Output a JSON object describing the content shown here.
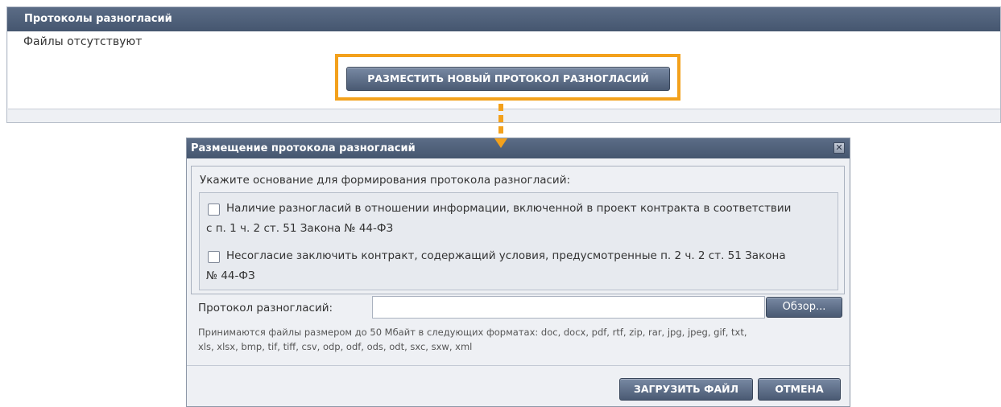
{
  "panel": {
    "title": "Протоколы разногласий",
    "empty_text": "Файлы отсутствуют",
    "place_button": "РАЗМЕСТИТЬ НОВЫЙ ПРОТОКОЛ РАЗНОГЛАСИЙ"
  },
  "colors": {
    "header": "#4e5f79",
    "highlight": "#f3a11c"
  },
  "dialog": {
    "title": "Размещение протокола разногласий",
    "close_icon": "close-icon",
    "basis_label": "Укажите основание для формирования протокола разногласий:",
    "options": [
      {
        "line1": "Наличие разногласий в отношении информации, включенной в проект контракта в соответствии",
        "line2": "с п. 1 ч. 2 ст. 51 Закона № 44-ФЗ",
        "checked": false
      },
      {
        "line1": "Несогласие заключить контракт, содержащий условия, предусмотренные п. 2 ч. 2 ст. 51 Закона",
        "line2": "№ 44-ФЗ",
        "checked": false
      }
    ],
    "file_label": "Протокол разногласий:",
    "file_value": "",
    "browse_button": "Обзор...",
    "hint_line1": "Принимаются файлы размером до 50 Мбайт в следующих форматах: doc, docx, pdf, rtf, zip, rar, jpg, jpeg, gif, txt,",
    "hint_line2": "xls, xlsx, bmp, tif, tiff, csv, odp, odf, ods, odt, sxc, sxw, xml",
    "upload_button": "ЗАГРУЗИТЬ ФАЙЛ",
    "cancel_button": "ОТМЕНА"
  }
}
